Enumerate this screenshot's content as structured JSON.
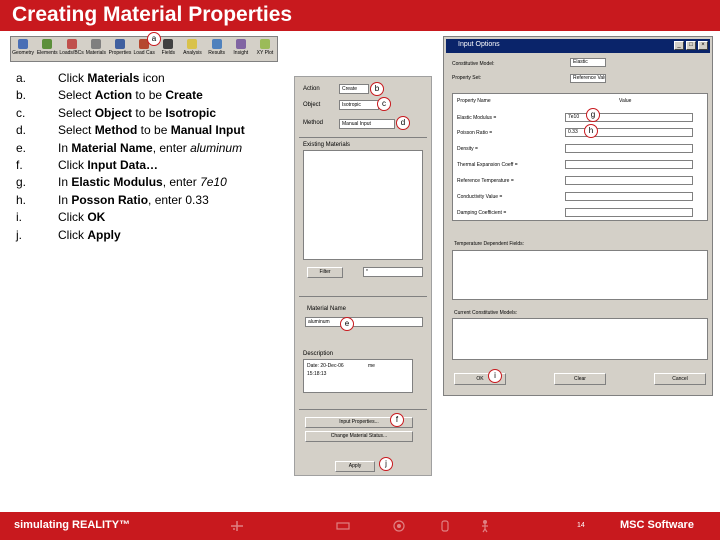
{
  "title": "Creating Material Properties",
  "toolbar": {
    "items": [
      {
        "label": "Geometry",
        "icon": "geometry-icon"
      },
      {
        "label": "Elements",
        "icon": "elements-icon"
      },
      {
        "label": "Loads/BCs",
        "icon": "loads-bcs-icon"
      },
      {
        "label": "Materials",
        "icon": "materials-icon"
      },
      {
        "label": "Properties",
        "icon": "properties-icon"
      },
      {
        "label": "Load Cas",
        "icon": "load-cases-icon"
      },
      {
        "label": "Fields",
        "icon": "fields-icon"
      },
      {
        "label": "Analysis",
        "icon": "analysis-icon"
      },
      {
        "label": "Results",
        "icon": "results-icon"
      },
      {
        "label": "Insight",
        "icon": "insight-icon"
      },
      {
        "label": "XY Plot",
        "icon": "xy-plot-icon"
      }
    ]
  },
  "callouts": {
    "a": "a",
    "b": "b",
    "c": "c",
    "d": "d",
    "e": "e",
    "f": "f",
    "g": "g",
    "h": "h",
    "i": "i",
    "j": "j"
  },
  "steps": [
    {
      "letter": "a.",
      "pre": "Click ",
      "bold": "Materials",
      "post": " icon",
      "bold2": "",
      "post2": "",
      "italic": ""
    },
    {
      "letter": "b.",
      "pre": "Select ",
      "bold": "Action",
      "post": " to be ",
      "bold2": "Create",
      "post2": "",
      "italic": ""
    },
    {
      "letter": "c.",
      "pre": "Select ",
      "bold": "Object",
      "post": " to be ",
      "bold2": "Isotropic",
      "post2": "",
      "italic": ""
    },
    {
      "letter": "d.",
      "pre": "Select ",
      "bold": "Method",
      "post": " to be ",
      "bold2": "Manual Input",
      "post2": "",
      "italic": ""
    },
    {
      "letter": "e.",
      "pre": "In ",
      "bold": "Material Name",
      "post": ", enter ",
      "bold2": "",
      "post2": "",
      "italic": "aluminum"
    },
    {
      "letter": "f.",
      "pre": "Click ",
      "bold": "Input Data…",
      "post": "",
      "bold2": "",
      "post2": "",
      "italic": ""
    },
    {
      "letter": "g.",
      "pre": "In ",
      "bold": "Elastic Modulus",
      "post": ", enter ",
      "bold2": "",
      "post2": "",
      "italic": "7e10"
    },
    {
      "letter": "h.",
      "pre": "In ",
      "bold": "Posson Ratio",
      "post": ", enter 0.33",
      "bold2": "",
      "post2": "",
      "italic": ""
    },
    {
      "letter": "i.",
      "pre": "Click ",
      "bold": "OK",
      "post": "",
      "bold2": "",
      "post2": "",
      "italic": ""
    },
    {
      "letter": "j.",
      "pre": "Click ",
      "bold": "Apply",
      "post": "",
      "bold2": "",
      "post2": "",
      "italic": ""
    }
  ],
  "materials_panel": {
    "action_label": "Action",
    "action_value": "Create",
    "object_label": "Object",
    "object_value": "Isotropic",
    "method_label": "Method",
    "method_value": "Manual Input",
    "existing_label": "Existing Materials",
    "filter_button": "Filter",
    "filter_value": "*",
    "name_label": "Material Name",
    "name_value": "aluminum",
    "description_label": "Description",
    "description_line1": "Date: 20-Dec-06",
    "description_line2": "15:18:13",
    "description_time": "me",
    "input_props_button": "Input Properties...",
    "change_status_button": "Change Material Status...",
    "apply_button": "Apply"
  },
  "dialog": {
    "title": "Input Options",
    "constitutive_label": "Constitutive Model:",
    "constitutive_value": "Elastic",
    "property_set_label": "Property Set:",
    "property_set_value": "Reference Values",
    "property_name_header": "Property Name",
    "value_header": "Value",
    "properties": [
      {
        "name": "Elastic Modulus =",
        "value": "7e10"
      },
      {
        "name": "Poisson Ratio =",
        "value": "0.33"
      },
      {
        "name": "Density =",
        "value": ""
      },
      {
        "name": "Thermal Expansion Coeff =",
        "value": ""
      },
      {
        "name": "Reference Temperature =",
        "value": ""
      },
      {
        "name": "Conductivity Value =",
        "value": ""
      },
      {
        "name": "Damping Coefficient =",
        "value": ""
      }
    ],
    "dependent_fields_label": "Temperature Dependent Fields:",
    "current_models_label": "Current Constitutive Models:",
    "ok_button": "OK",
    "clear_button": "Clear",
    "cancel_button": "Cancel"
  },
  "footer": {
    "brand": "simulating REALITY™",
    "page_number": "14",
    "logo": "MSC Software"
  },
  "colors": {
    "brand_red": "#c8191e",
    "dialog_title": "#0a246a",
    "panel_gray": "#d4d0c8"
  }
}
